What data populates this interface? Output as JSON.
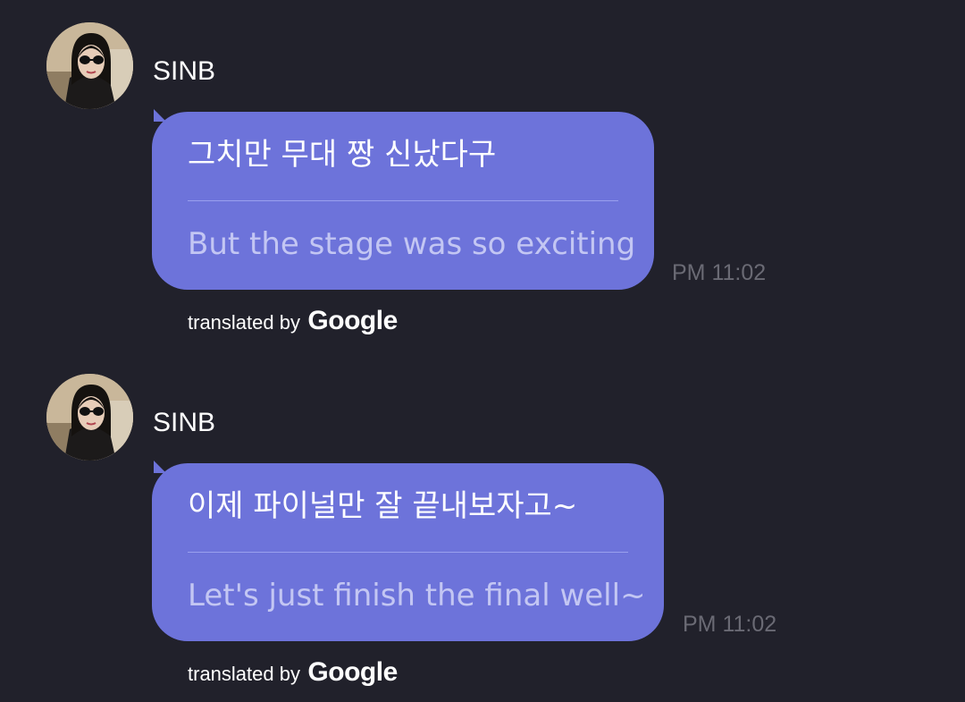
{
  "messages": [
    {
      "sender": "SINB",
      "original_text": "그치만 무대 짱 신났다구",
      "translated_text": "But the stage was so exciting",
      "time": "PM 11:02",
      "credit_prefix": "translated by",
      "credit_brand": "Google"
    },
    {
      "sender": "SINB",
      "original_text": "이제 파이널만 잘 끝내보자고~",
      "translated_text": "Let's just finish the final well~",
      "time": "PM 11:02",
      "credit_prefix": "translated by",
      "credit_brand": "Google"
    }
  ],
  "colors": {
    "background": "#21212b",
    "bubble": "#6d73da",
    "original_text": "#ffffff",
    "translated_text": "#c3c6f3",
    "timestamp": "#6a6a74"
  }
}
